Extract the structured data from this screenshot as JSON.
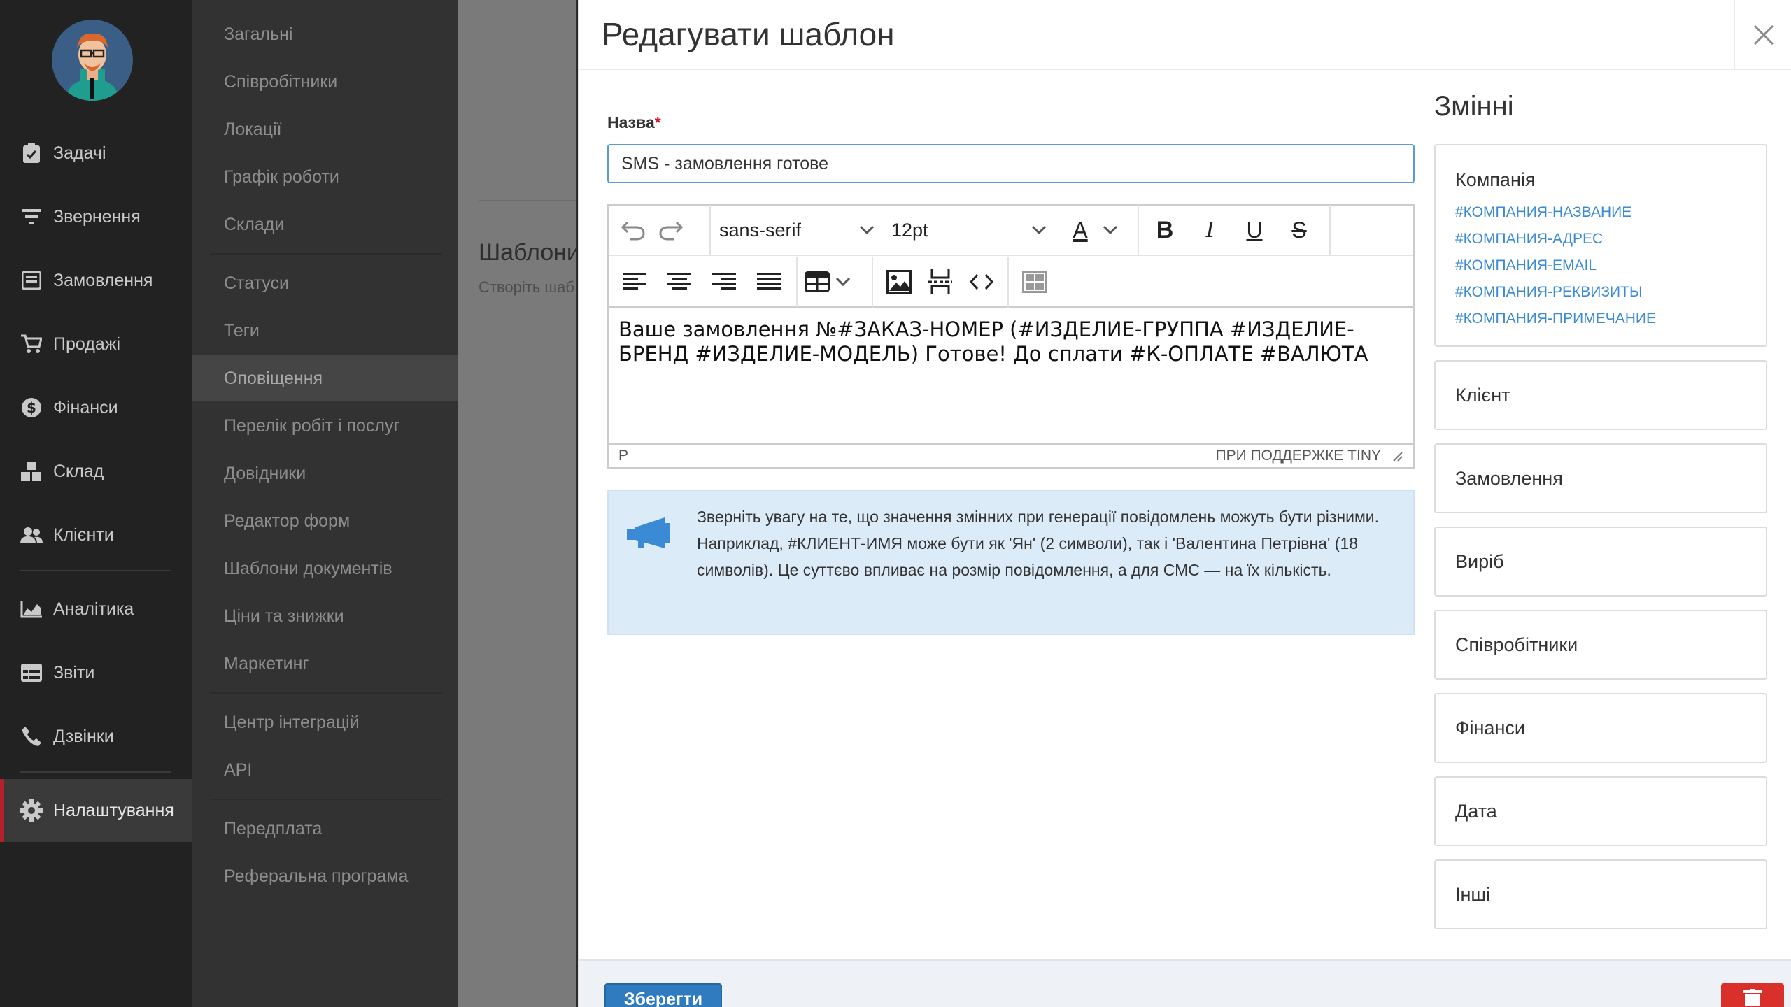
{
  "nav": {
    "items": [
      {
        "label": "Задачі",
        "icon": "clipboard-check-icon"
      },
      {
        "label": "Звернення",
        "icon": "filter-icon"
      },
      {
        "label": "Замовлення",
        "icon": "order-icon"
      },
      {
        "label": "Продажі",
        "icon": "cart-icon"
      },
      {
        "label": "Фінанси",
        "icon": "dollar-icon"
      },
      {
        "label": "Склад",
        "icon": "boxes-icon"
      },
      {
        "label": "Клієнти",
        "icon": "users-icon"
      },
      {
        "label": "Аналітика",
        "icon": "area-chart-icon"
      },
      {
        "label": "Звіти",
        "icon": "report-table-icon"
      },
      {
        "label": "Дзвінки",
        "icon": "phone-icon"
      },
      {
        "label": "Налаштування",
        "icon": "gear-icon"
      }
    ],
    "active": "Налаштування"
  },
  "submenu": {
    "items": [
      "Загальні",
      "Співробітники",
      "Локації",
      "Графік роботи",
      "Склади",
      "Статуси",
      "Теги",
      "Оповіщення",
      "Перелік робіт і послуг",
      "Довідники",
      "Редактор форм",
      "Шаблони документів",
      "Ціни та знижки",
      "Маркетинг",
      "Центр інтеграцій",
      "API",
      "Передплата",
      "Реферальна програма"
    ],
    "active": "Оповіщення"
  },
  "background_page": {
    "title": "Шаблони",
    "subtitle": "Створіть шаб"
  },
  "modal": {
    "title": "Редагувати шаблон",
    "name_label": "Назва",
    "required_mark": "*",
    "name_value": "SMS - замовлення готове",
    "editor": {
      "font_family": "sans-serif",
      "font_size": "12pt",
      "color_letter": "A",
      "content": "Ваше замовлення №#ЗАКАЗ-НОМЕР (#ИЗДЕЛИЕ-ГРУППА #ИЗДЕЛИЕ-БРЕНД #ИЗДЕЛИЕ-МОДЕЛЬ) Готове! До сплати #К-ОПЛАТЕ #ВАЛЮТА",
      "status_path": "P",
      "powered_by": "ПРИ ПОДДЕРЖКЕ TINY"
    },
    "info_text": "Зверніть увагу на те, що значення змінних при генерації повідомлень можуть бути різними. Наприклад, #КЛИЕНТ-ИМЯ може бути як 'Ян' (2 символи), так і 'Валентина Петрівна' (18 символів). Це суттєво впливає на розмір повідомлення, а для СМС — на їх кількість.",
    "save_label": "Зберегти"
  },
  "variables": {
    "title": "Змінні",
    "company": {
      "title": "Компанія",
      "items": [
        "#КОМПАНИЯ-НАЗВАНИЕ",
        "#КОМПАНИЯ-АДРЕС",
        "#КОМПАНИЯ-EMAIL",
        "#КОМПАНИЯ-РЕКВИЗИТЫ",
        "#КОМПАНИЯ-ПРИМЕЧАНИЕ"
      ]
    },
    "groups": [
      "Клієнт",
      "Замовлення",
      "Виріб",
      "Співробітники",
      "Фінанси",
      "Дата",
      "Інші"
    ]
  },
  "colors": {
    "nav_bg": "#222222",
    "submenu_bg": "#323232",
    "accent_red": "#b3212b",
    "link_blue": "#3b8ad6",
    "save_blue": "#2f7bc0",
    "delete_red": "#d9302c",
    "info_bg": "#dcebf8"
  }
}
